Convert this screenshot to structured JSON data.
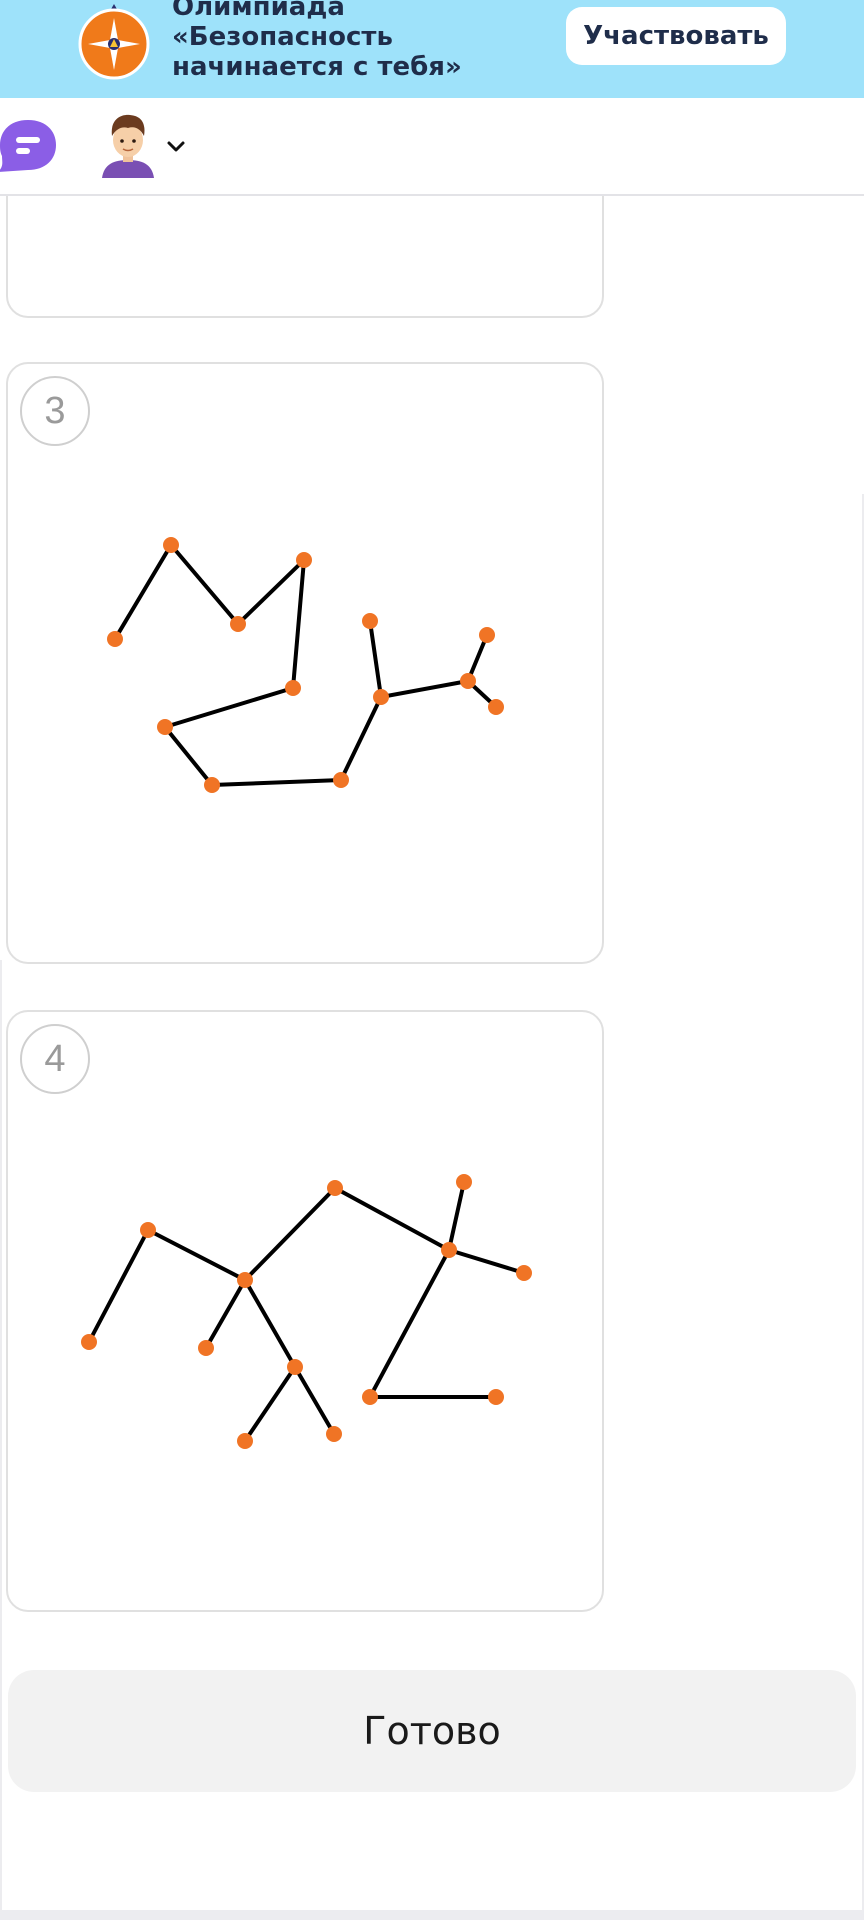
{
  "banner": {
    "title_lines": [
      "Олимпиада",
      "«Безопасность",
      "начинается с тебя»"
    ],
    "participate_label": "Участвовать",
    "logo_icon": "compass-emblem-icon",
    "background_color": "#9ee2fa"
  },
  "header": {
    "chat_icon": "chat-bubble-icon",
    "avatar_icon": "boy-avatar-icon",
    "dropdown_icon": "chevron-down-icon"
  },
  "cards": [
    {
      "number": ""
    },
    {
      "number": "3",
      "figure": "constellation-graph-3"
    },
    {
      "number": "4",
      "figure": "constellation-graph-4"
    }
  ],
  "done_label": "Готово",
  "colors": {
    "node": "#f07425",
    "edge": "#000000",
    "chat_accent": "#8b5ee6"
  }
}
